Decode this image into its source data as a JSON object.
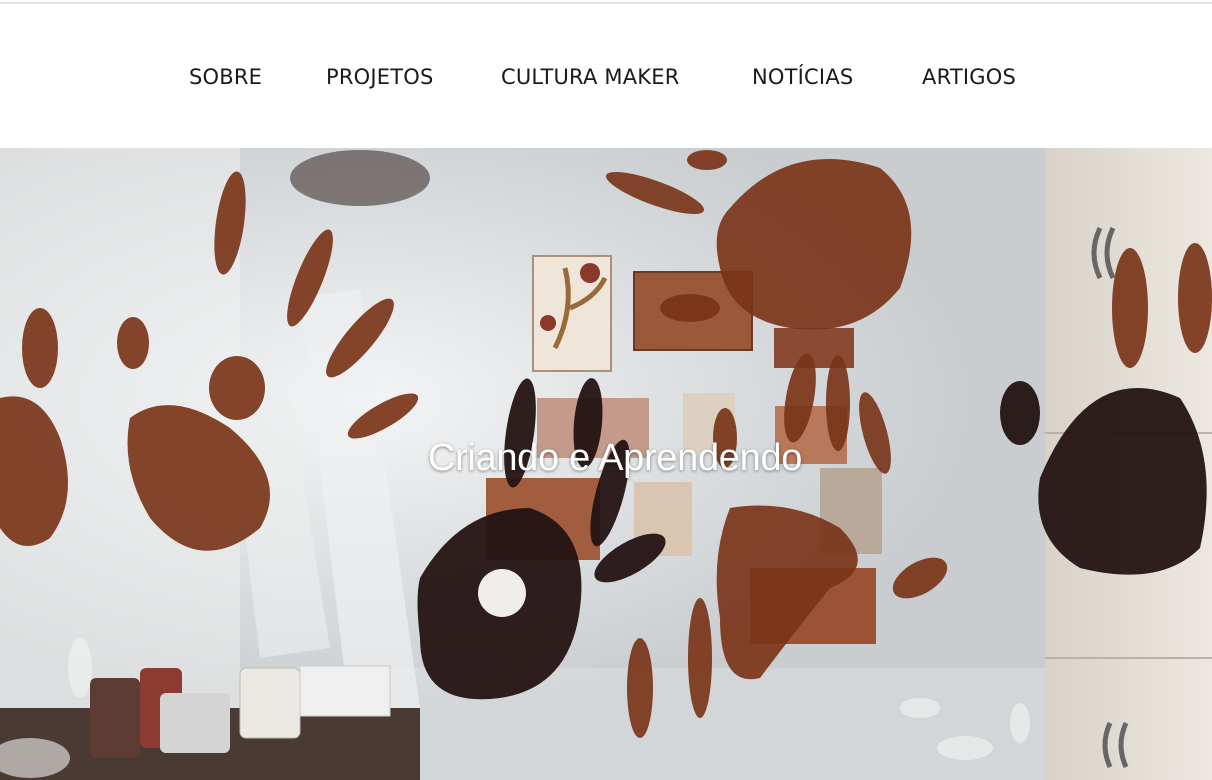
{
  "nav": {
    "items": [
      {
        "label": "SOBRE"
      },
      {
        "label": "PROJETOS"
      },
      {
        "label": "CULTURA MAKER"
      },
      {
        "label": "NOTÍCIAS"
      },
      {
        "label": "ARTIGOS"
      }
    ]
  },
  "hero": {
    "title": "Criando e Aprendendo"
  },
  "colors": {
    "nav_text": "#1a1a1a",
    "hero_title": "#ffffff",
    "paint_brown": "#6b2f1a",
    "paint_dark": "#231212"
  }
}
